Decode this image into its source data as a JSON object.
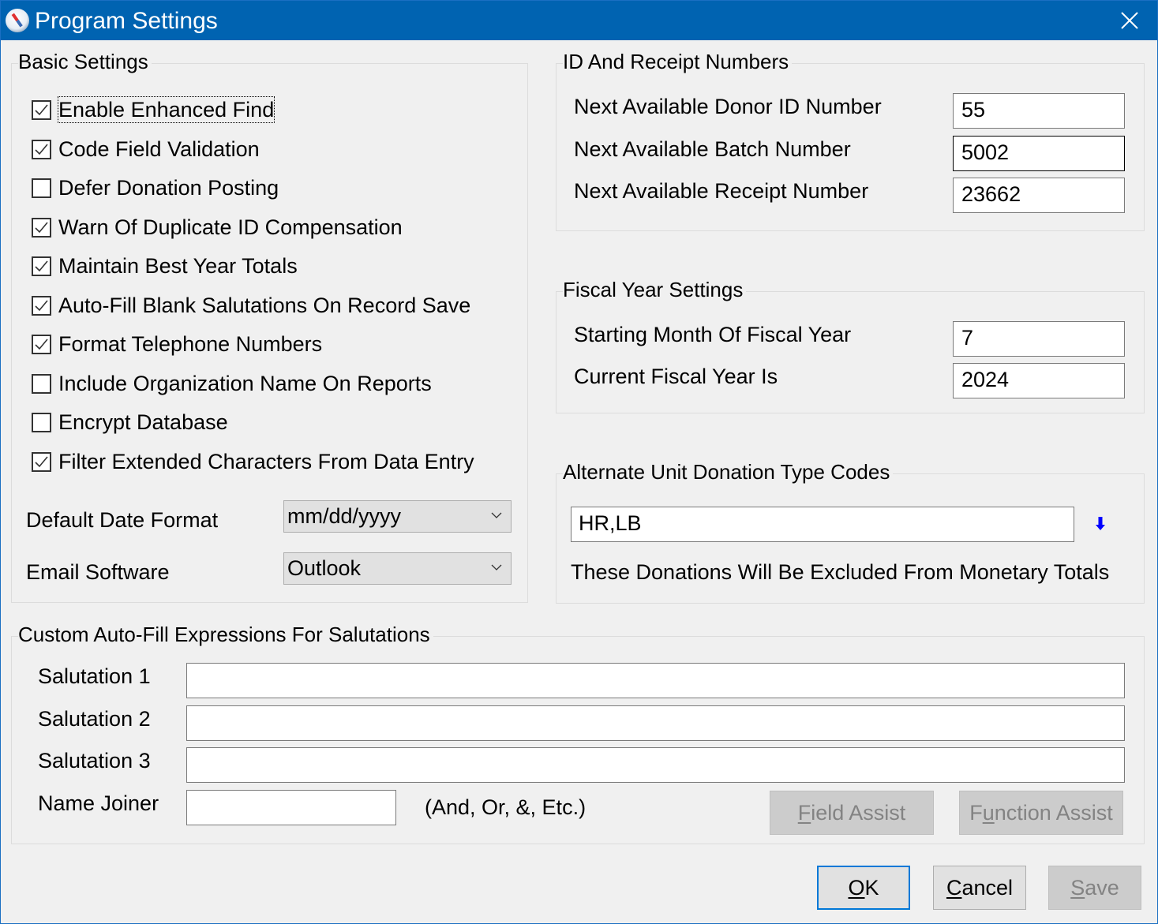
{
  "window": {
    "title": "Program Settings",
    "icon": "compass-icon",
    "close_icon": "close-icon"
  },
  "basic_settings": {
    "title": "Basic Settings",
    "checkboxes": [
      {
        "label": "Enable Enhanced Find",
        "checked": true,
        "focused": true
      },
      {
        "label": "Code Field Validation",
        "checked": true
      },
      {
        "label": "Defer Donation Posting",
        "checked": false
      },
      {
        "label": "Warn Of Duplicate ID Compensation",
        "checked": true
      },
      {
        "label": "Maintain Best Year Totals",
        "checked": true
      },
      {
        "label": "Auto-Fill Blank Salutations On Record Save",
        "checked": true
      },
      {
        "label": "Format Telephone Numbers",
        "checked": true
      },
      {
        "label": "Include Organization Name On Reports",
        "checked": false
      },
      {
        "label": "Encrypt Database",
        "checked": false
      },
      {
        "label": "Filter Extended Characters From Data Entry",
        "checked": true
      }
    ],
    "date_format": {
      "label": "Default Date Format",
      "value": "mm/dd/yyyy"
    },
    "email_software": {
      "label": "Email Software",
      "value": "Outlook"
    }
  },
  "id_receipt": {
    "title": "ID And Receipt Numbers",
    "fields": [
      {
        "label": "Next Available Donor ID Number",
        "value": "55"
      },
      {
        "label": "Next Available Batch Number",
        "value": "5002"
      },
      {
        "label": "Next Available Receipt Number",
        "value": "23662"
      }
    ]
  },
  "fiscal_year": {
    "title": "Fiscal Year Settings",
    "fields": [
      {
        "label": "Starting Month Of Fiscal Year",
        "value": "7"
      },
      {
        "label": "Current Fiscal Year Is",
        "value": "2024"
      }
    ]
  },
  "alt_unit": {
    "title": "Alternate Unit Donation Type Codes",
    "value": "HR,LB",
    "lookup_icon": "down-arrow-icon",
    "note": "These Donations Will Be Excluded From Monetary Totals"
  },
  "salutations": {
    "title": "Custom Auto-Fill Expressions For Salutations",
    "fields": [
      {
        "label": "Salutation 1",
        "value": ""
      },
      {
        "label": "Salutation 2",
        "value": ""
      },
      {
        "label": "Salutation 3",
        "value": ""
      }
    ],
    "joiner": {
      "label": "Name Joiner",
      "value": "",
      "hint": "(And, Or, &, Etc.)"
    },
    "field_assist": {
      "prefix": "",
      "accel": "F",
      "rest": "ield Assist"
    },
    "function_assist": {
      "prefix": "F",
      "accel": "u",
      "rest": "nction Assist"
    }
  },
  "buttons": {
    "ok": {
      "accel": "O",
      "rest": "K"
    },
    "cancel": {
      "accel": "C",
      "rest": "ancel"
    },
    "save": {
      "accel": "S",
      "rest": "ave"
    }
  },
  "colors": {
    "titlebar": "#0063b1",
    "focus_border": "#0078d7",
    "lookup_arrow": "#0000ff"
  }
}
